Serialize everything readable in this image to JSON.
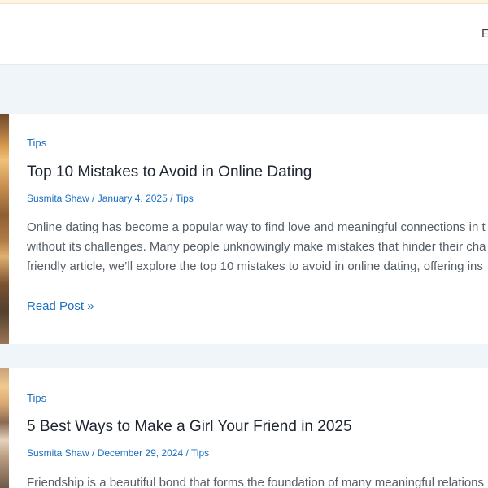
{
  "header": {
    "nav_item": "E"
  },
  "posts": [
    {
      "category": "Tips",
      "title": "Top 10 Mistakes to Avoid in Online Dating",
      "author": "Susmita Shaw",
      "date": "January 4, 2025",
      "meta_category": "Tips",
      "excerpt": [
        "Online dating has become a popular way to find love and meaningful connections in t",
        "without its challenges. Many people unknowingly make mistakes that hinder their cha",
        "friendly article, we’ll explore the top 10 mistakes to avoid in online dating, offering ins"
      ],
      "read_more": "Read Post »"
    },
    {
      "category": "Tips",
      "title": "5 Best Ways to Make a Girl Your Friend in 2025",
      "author": "Susmita Shaw",
      "date": "December 29, 2024",
      "meta_category": "Tips",
      "excerpt": [
        "Friendship is a beautiful bond that forms the foundation of many meaningful relations"
      ]
    }
  ],
  "separator": " / "
}
